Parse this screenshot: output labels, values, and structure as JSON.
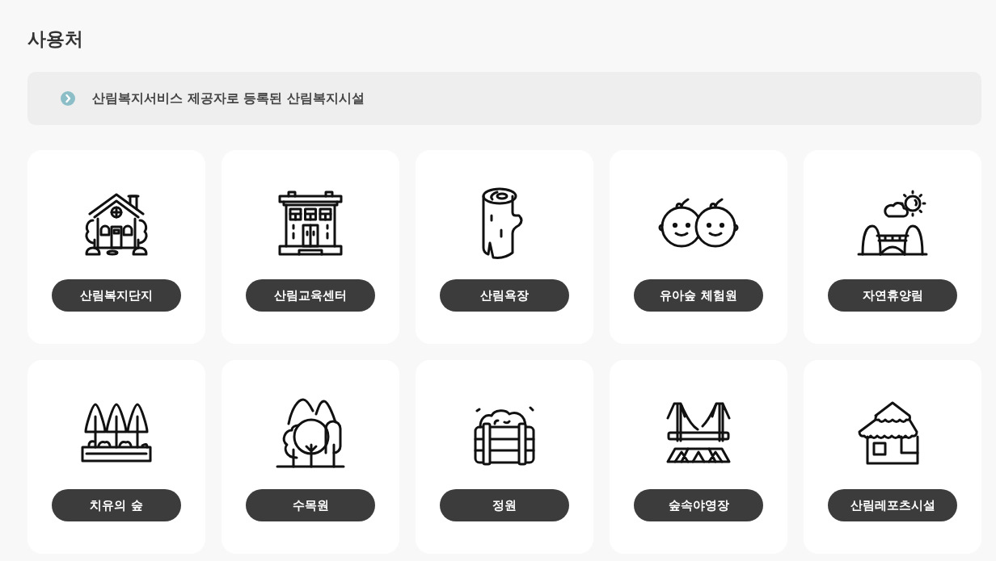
{
  "title": "사용처",
  "notice": {
    "text": "산림복지서비스 제공자로 등록된 산림복지시설"
  },
  "facilities": [
    {
      "label": "산림복지단지",
      "kind": "house"
    },
    {
      "label": "산림교육센터",
      "kind": "building"
    },
    {
      "label": "산림욕장",
      "kind": "log"
    },
    {
      "label": "유아숲 체험원",
      "kind": "babies"
    },
    {
      "label": "자연휴양림",
      "kind": "park"
    },
    {
      "label": "치유의 숲",
      "kind": "trees"
    },
    {
      "label": "수목원",
      "kind": "forest"
    },
    {
      "label": "정원",
      "kind": "garden"
    },
    {
      "label": "숲속야영장",
      "kind": "camp"
    },
    {
      "label": "산림레포츠시설",
      "kind": "hut"
    }
  ]
}
